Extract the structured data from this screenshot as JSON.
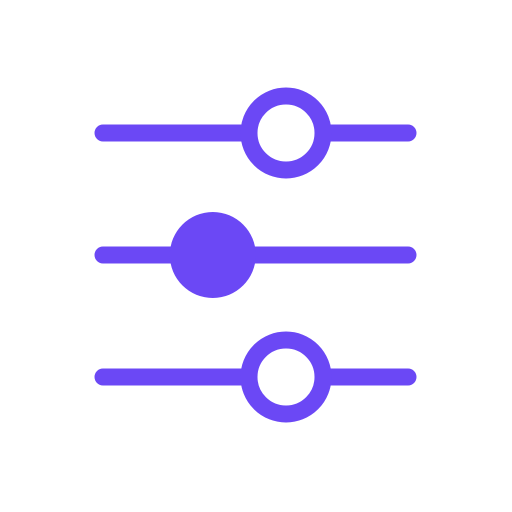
{
  "icon": {
    "name": "sliders-icon",
    "accent_color": "#6b48f5",
    "background_color": "#ffffff",
    "sliders": [
      {
        "name": "slider-top",
        "level": 0.6,
        "knob_style": "hollow"
      },
      {
        "name": "slider-middle",
        "level": 0.36,
        "knob_style": "filled"
      },
      {
        "name": "slider-bottom",
        "level": 0.6,
        "knob_style": "hollow"
      }
    ]
  }
}
